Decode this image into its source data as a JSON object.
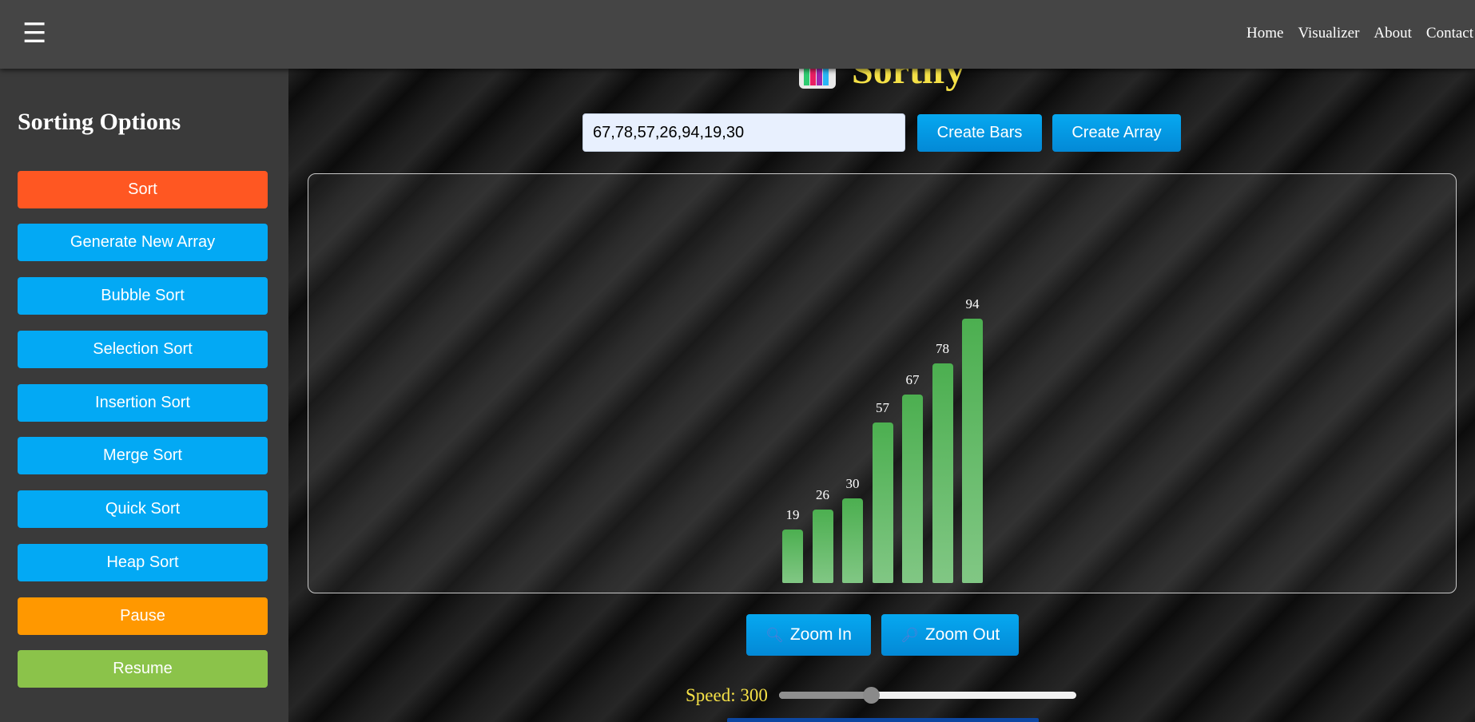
{
  "nav": {
    "menu_icon": "hamburger-icon",
    "links": [
      "Home",
      "Visualizer",
      "About",
      "Contact"
    ]
  },
  "sidebar": {
    "title": "Sorting Options",
    "buttons": [
      {
        "label": "Sort",
        "color": "#ff5722"
      },
      {
        "label": "Generate New Array",
        "color": "#03a9f4"
      },
      {
        "label": "Bubble Sort",
        "color": "#03a9f4"
      },
      {
        "label": "Selection Sort",
        "color": "#03a9f4"
      },
      {
        "label": "Insertion Sort",
        "color": "#03a9f4"
      },
      {
        "label": "Merge Sort",
        "color": "#03a9f4"
      },
      {
        "label": "Quick Sort",
        "color": "#03a9f4"
      },
      {
        "label": "Heap Sort",
        "color": "#03a9f4"
      },
      {
        "label": "Pause",
        "color": "#ff9800"
      },
      {
        "label": "Resume",
        "color": "#8bc34a"
      }
    ]
  },
  "main": {
    "title": "Sortify",
    "logo_icon": "bar-chart-icon",
    "input_value": "67,78,57,26,94,19,30",
    "create_bars_label": "Create Bars",
    "create_array_label": "Create Array",
    "zoom_in_label": "Zoom In",
    "zoom_out_label": "Zoom Out",
    "zoom_in_icon": "magnifier-icon",
    "zoom_out_icon": "magnifier-icon",
    "speed_label": "Speed: 300",
    "speed_value": 300,
    "speed_fraction": 0.31
  },
  "chart_data": {
    "type": "bar",
    "values": [
      19,
      26,
      30,
      57,
      67,
      78,
      94
    ],
    "bar_color": "#4caf50"
  }
}
